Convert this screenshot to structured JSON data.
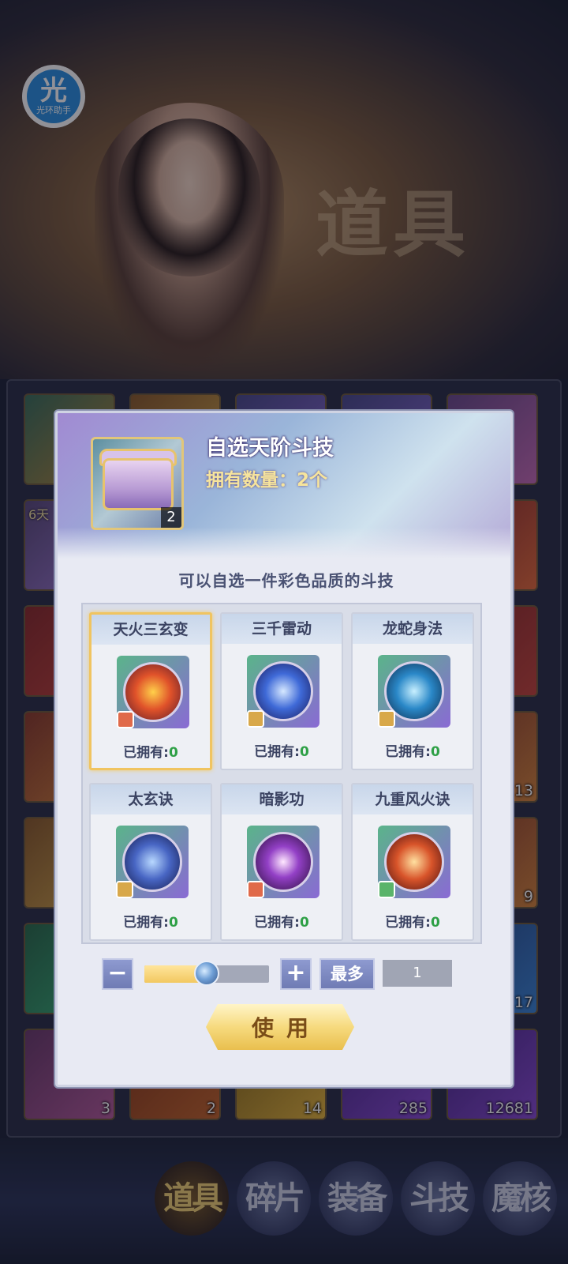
{
  "logo": {
    "char": "光",
    "text": "光环助手"
  },
  "background": {
    "title": "道具"
  },
  "inventory": {
    "tag": "6天",
    "counts": [
      "13",
      "9",
      "17",
      "3",
      "2",
      "14",
      "285",
      "12681"
    ]
  },
  "dialog": {
    "item_name": "自选天阶斗技",
    "owned_label": "拥有数量：2个",
    "item_count": "2",
    "hint": "可以自选一件彩色品质的斗技",
    "skills": [
      {
        "name": "天火三玄变",
        "own_label": "已拥有:",
        "own_value": "0",
        "icon": "fire-figure-icon",
        "color": "#e0522a"
      },
      {
        "name": "三千雷动",
        "own_label": "已拥有:",
        "own_value": "0",
        "icon": "lightning-icon",
        "color": "#3f6ad8"
      },
      {
        "name": "龙蛇身法",
        "own_label": "已拥有:",
        "own_value": "0",
        "icon": "water-dash-icon",
        "color": "#2a88c8"
      },
      {
        "name": "太玄诀",
        "own_label": "已拥有:",
        "own_value": "0",
        "icon": "blue-warrior-icon",
        "color": "#4866c4"
      },
      {
        "name": "暗影功",
        "own_label": "已拥有:",
        "own_value": "0",
        "icon": "shadow-orb-icon",
        "color": "#9340c6"
      },
      {
        "name": "九重风火诀",
        "own_label": "已拥有:",
        "own_value": "0",
        "icon": "phoenix-icon",
        "color": "#d8542a"
      }
    ],
    "quantity": {
      "minus": "−",
      "plus": "+",
      "max_label": "最多",
      "value": "1",
      "slider_fraction": 0.5
    },
    "use_label": "使用"
  },
  "tabs": [
    {
      "label": "道具",
      "active": true
    },
    {
      "label": "碎片",
      "active": false
    },
    {
      "label": "装备",
      "active": false
    },
    {
      "label": "斗技",
      "active": false
    },
    {
      "label": "魔核",
      "active": false
    }
  ]
}
